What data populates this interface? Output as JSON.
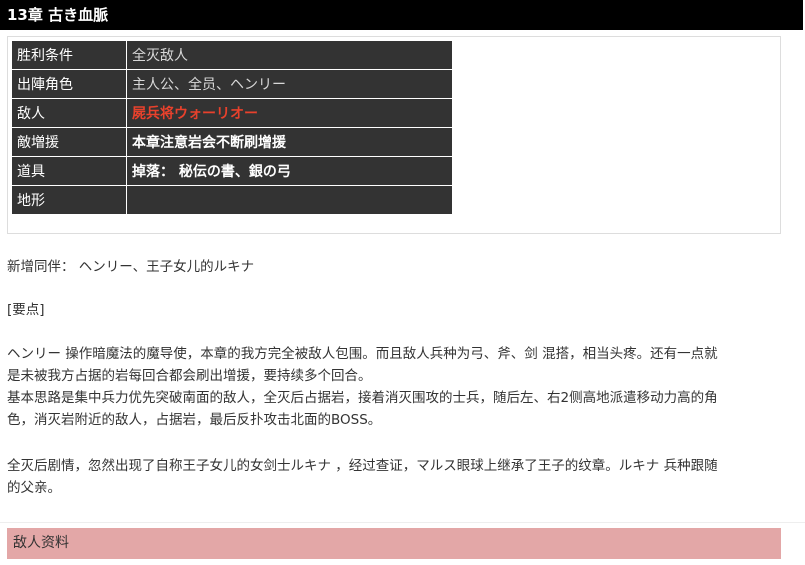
{
  "header": {
    "title": "13章 古き血脈"
  },
  "info_table": {
    "rows": [
      {
        "key": "胜利条件",
        "value": "全灭敌人"
      },
      {
        "key": "出陣角色",
        "value": "主人公、全员、ヘンリー"
      },
      {
        "key": "敌人",
        "value": "屍兵将ウォーリオー"
      },
      {
        "key": "敵増援",
        "value": "本章注意岩会不断刷增援"
      },
      {
        "key": "道具",
        "value": "掉落： 秘伝の書、銀の弓"
      },
      {
        "key": "地形",
        "value": ""
      }
    ]
  },
  "body": {
    "new_ally": "新增同伴： ヘンリー、王子女儿的ルキナ",
    "key_points_heading": "[要点]",
    "para1_line1": "ヘンリー 操作暗魔法的魔导使，本章的我方完全被敌人包围。而且敌人兵种为弓、斧、剑 混搭，相当头疼。还有一点就",
    "para1_line2": "是未被我方占据的岩每回合都会刷出增援，要持续多个回合。",
    "para2_line1": "基本思路是集中兵力优先突破南面的敌人，全灭后占据岩，接着消灭围攻的士兵，随后左、右2侧高地派遣移动力高的角",
    "para2_line2": "色，消灭岩附近的敌人，占据岩，最后反扑攻击北面的BOSS。",
    "para3_line1": "全灭后剧情，忽然出现了自称王子女儿的女剑士ルキナ ，经过查证，マルス眼球上继承了王子的纹章。ルキナ 兵种跟随",
    "para3_line2": "的父亲。"
  },
  "section": {
    "enemy_data_label": "敌人资料"
  },
  "colors": {
    "header_bg": "#000000",
    "table_bg": "#333333",
    "enemy_red": "#e8412c",
    "section_bg": "#e3a7a7"
  }
}
